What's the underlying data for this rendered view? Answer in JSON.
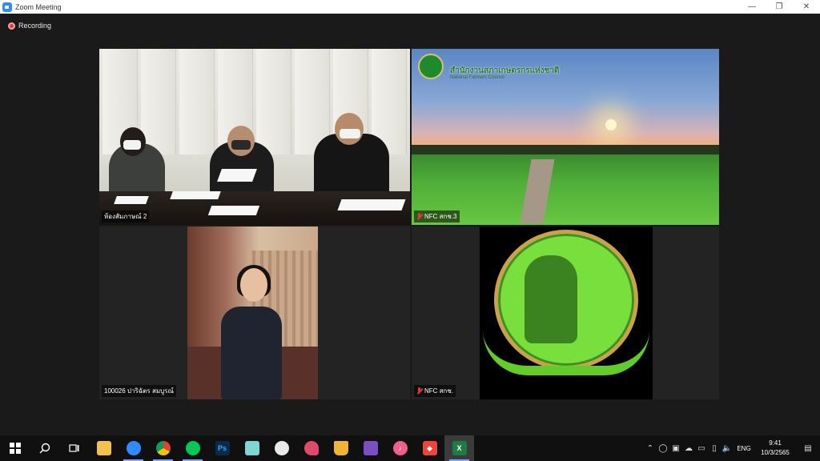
{
  "window": {
    "title": "Zoom Meeting",
    "controls": {
      "minimize": "—",
      "restore": "❐",
      "close": "✕"
    }
  },
  "meeting": {
    "recording_label": "Recording",
    "tiles": [
      {
        "label": "ห้องสัมภาษณ์ 2",
        "muted": false,
        "active": true
      },
      {
        "label": "NFC สกช.3",
        "muted": true,
        "active": false
      },
      {
        "label": "100026 ปาริฉัตร สมบูรณ์",
        "muted": false,
        "active": false
      },
      {
        "label": "NFC สกช.",
        "muted": true,
        "active": false
      }
    ],
    "tile2_overlay": {
      "title": "สำนักงานสภาเกษตรกรแห่งชาติ",
      "subtitle": "National Farmers Council"
    }
  },
  "taskbar": {
    "apps": [
      {
        "name": "start",
        "icon": "windows-icon"
      },
      {
        "name": "search",
        "icon": "search-icon"
      },
      {
        "name": "task-view",
        "icon": "task-view-icon"
      },
      {
        "name": "file-explorer",
        "icon": "folder-icon",
        "color": "#f2c14e"
      },
      {
        "name": "zoom",
        "icon": "zoom-icon",
        "color": "#2d8cff",
        "running": true
      },
      {
        "name": "chrome",
        "icon": "chrome-icon",
        "color": "#db4437",
        "running": true
      },
      {
        "name": "line",
        "icon": "line-icon",
        "color": "#06c755",
        "running": true
      },
      {
        "name": "photoshop",
        "icon": "photoshop-icon",
        "color": "#0a2a4a"
      },
      {
        "name": "notepad",
        "icon": "notepad-icon",
        "color": "#7fd6d6"
      },
      {
        "name": "app-panda",
        "icon": "panda-icon",
        "color": "#e8e8e8"
      },
      {
        "name": "app-paint",
        "icon": "paint-icon",
        "color": "#e04a6a"
      },
      {
        "name": "app-drink",
        "icon": "cup-icon",
        "color": "#f2b233"
      },
      {
        "name": "visual-studio",
        "icon": "visual-studio-icon",
        "color": "#7b4fc4"
      },
      {
        "name": "itunes",
        "icon": "music-icon",
        "color": "#f25f8a"
      },
      {
        "name": "anydesk",
        "icon": "anydesk-icon",
        "color": "#ef443b"
      },
      {
        "name": "excel",
        "icon": "excel-icon",
        "color": "#1f7a45",
        "running": true,
        "active": true
      }
    ],
    "tray": {
      "language": "ENG",
      "time": "9:41",
      "date": "10/3/2565"
    }
  }
}
